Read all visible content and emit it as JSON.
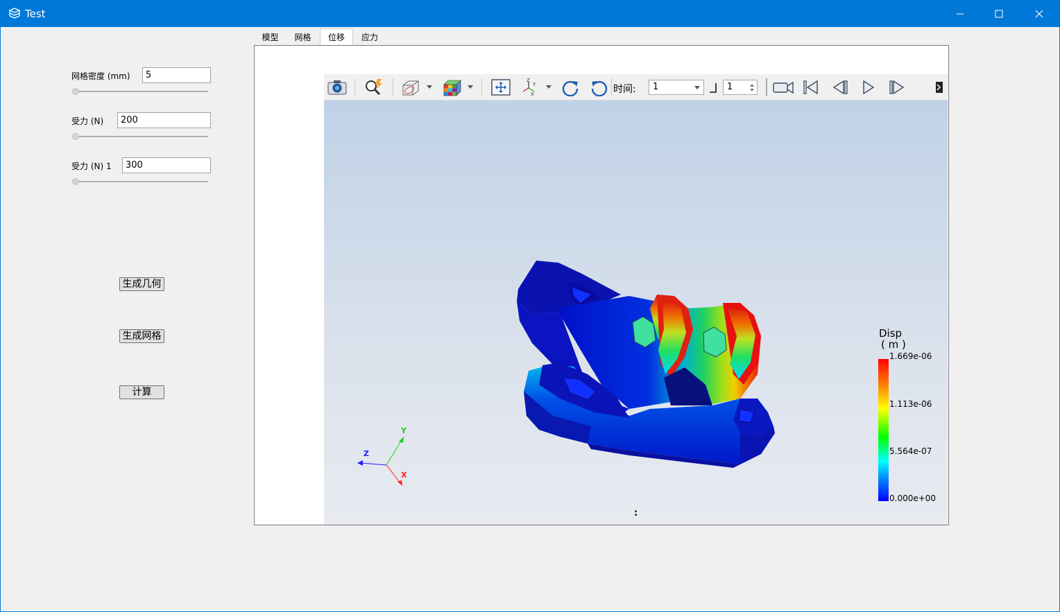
{
  "window": {
    "title": "Test",
    "icon": "app-icon",
    "controls": [
      "minimize-icon",
      "maximize-icon",
      "close-icon"
    ]
  },
  "form": {
    "mesh_density": {
      "label": "网格密度 (mm)",
      "value": "5",
      "slider": 0
    },
    "force_1": {
      "label": "受力 (N)",
      "value": "200",
      "slider": 0
    },
    "force_2": {
      "label": "受力 (N) 1",
      "value": "300",
      "slider": 0
    },
    "buttons": {
      "gen_geometry": "生成几何",
      "gen_mesh": "生成网格",
      "compute": "计算"
    }
  },
  "tabs": [
    {
      "label": "模型",
      "active": false
    },
    {
      "label": "网格",
      "active": false
    },
    {
      "label": "位移",
      "active": true
    },
    {
      "label": "应力",
      "active": false
    }
  ],
  "toolbar": {
    "icons": [
      "camera-icon",
      "zoom-magic-icon",
      "clip-plane-icon",
      "color-cube-icon",
      "fit-view-icon",
      "axes-orient-icon",
      "rotate-cw-icon",
      "rotate-ccw-icon",
      "record-video-icon",
      "first-frame-icon",
      "prev-frame-icon",
      "play-icon",
      "next-frame-icon",
      "more-icon"
    ],
    "time_label": "时间:",
    "time_value": "1",
    "spin_value": "1"
  },
  "scalar_bar": {
    "title": "Disp",
    "unit": "( m )",
    "ticks": [
      "1.669e-06",
      "1.113e-06",
      "5.564e-07",
      "0.000e+00"
    ],
    "colors": [
      "#ff0000",
      "#ffff00",
      "#00ff00",
      "#00ffff",
      "#0000ff"
    ]
  },
  "axes": {
    "x": "X",
    "y": "Y",
    "z": "Z",
    "x_color": "#ff2020",
    "y_color": "#20cc20",
    "z_color": "#2020ff"
  },
  "status": {
    "colon": ":"
  }
}
